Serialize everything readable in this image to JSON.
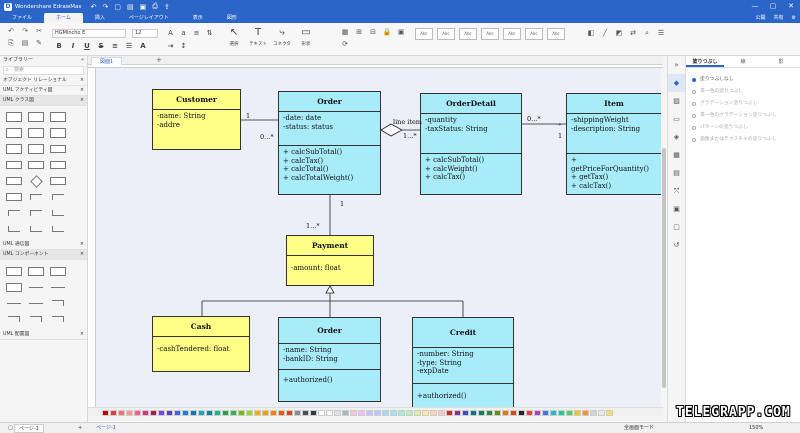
{
  "app": {
    "title": "Wondershare EdrawMax"
  },
  "menu": {
    "items": [
      "ファイル",
      "ホーム",
      "挿入",
      "ページレイアウト",
      "表示",
      "図形"
    ],
    "active_index": 1,
    "publish": "公開",
    "share": "共有"
  },
  "ribbon": {
    "font_name": "HGMincho E",
    "font_size": "12",
    "tools": [
      {
        "icon": "↖",
        "label": "選択"
      },
      {
        "icon": "T",
        "label": "テキスト"
      },
      {
        "icon": "⤷",
        "label": "コネクタ"
      },
      {
        "icon": "▭",
        "label": "形状"
      }
    ]
  },
  "tabs": {
    "document": "図面1"
  },
  "sidebar": {
    "library_label": "ライブラリー",
    "search_placeholder": "検索",
    "categories": [
      "オブジェクト リレーショナル",
      "UML アクティビティ図",
      "UML クラス図",
      "UML 通信図",
      "UML コンポーネント",
      "UML 配置図"
    ]
  },
  "right_panel": {
    "tabs": [
      "塗りつぶし",
      "線",
      "影"
    ],
    "options": [
      "塗りつぶしなし",
      "単一色の塗りつぶし",
      "グラデーション塗りつぶし",
      "単一色のグラデーション塗りつぶし",
      "パターンの塗りつぶし",
      "画像またはテクスチャの塗りつぶし"
    ],
    "selected_index": 0
  },
  "status": {
    "page_selector": "ページ-1",
    "page_tab": "ページ-1",
    "mode": "全画面モード",
    "zoom": "150%"
  },
  "watermark": "TELEGRAPP.COM",
  "diagram": {
    "customer": {
      "name": "Customer",
      "attrs": [
        "-name: String",
        "-addre"
      ]
    },
    "order": {
      "name": "Order",
      "attrs": [
        "-date: date",
        "-status: status"
      ],
      "ops": [
        "+ calcSubTotal()",
        "+ calcTax()",
        "+ calcTotal()",
        "+ calcTotalWeight()"
      ]
    },
    "orderdetail": {
      "name": "OrderDetail",
      "attrs": [
        "-quantity",
        "-taxStatus: String"
      ],
      "ops": [
        "+ calcSubTotal()",
        "+ calcWeight()",
        "+ calcTax()"
      ]
    },
    "item": {
      "name": "Item",
      "attrs": [
        "-shippingWeight",
        "-description: String"
      ],
      "ops": [
        "+ getPriceForQuantity()",
        "+ getTax()",
        "+ calcTax()"
      ]
    },
    "payment": {
      "name": "Payment",
      "attrs": [
        "-amount: float"
      ]
    },
    "cash": {
      "name": "Cash",
      "attrs": [
        "-cashTendered: float"
      ]
    },
    "order2": {
      "name": "Order",
      "attrs": [
        "-name: String",
        "-bankID: String"
      ],
      "ops": [
        "+authorized()"
      ]
    },
    "credit": {
      "name": "Credit",
      "attrs": [
        "-number: String",
        "-type: String",
        "-expDate"
      ],
      "ops": [
        "+authorized()"
      ]
    },
    "labels": {
      "cust_mult": "1",
      "order_mult": "0...*",
      "line_item": "line item",
      "od_mult": "1...*",
      "od_item_mult": "0...*",
      "item_mult": "1",
      "order_pay": "1",
      "pay_mult": "1...*"
    }
  },
  "colors": {
    "accent": "#2b65c7",
    "yellow": "#ffff88",
    "cyan": "#a8ecfa"
  }
}
